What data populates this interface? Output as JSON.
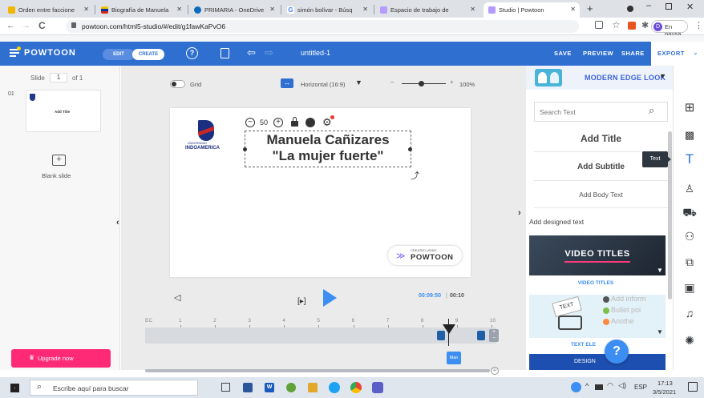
{
  "browser": {
    "tabs": [
      {
        "label": "Orden entre faccione",
        "color": "#f2b705",
        "active": false
      },
      {
        "label": "Biografía de Manuela",
        "color": "#d9261c",
        "active": false
      },
      {
        "label": "PRIMARIA - OneDrive",
        "color": "#0f6cbd",
        "active": false
      },
      {
        "label": "simón bolívar - Búsq",
        "color": "#4285f4",
        "active": false
      },
      {
        "label": "Espacio de trabajo de",
        "color": "#7b61ff",
        "active": false
      },
      {
        "label": "Studio | Powtoon",
        "color": "#7b61ff",
        "active": true
      }
    ],
    "new_tab": "+",
    "url": "powtoon.com/html5-studio/#/edit/g1fawKaPvO6",
    "profile_initial": "D",
    "profile_status": "En pausa"
  },
  "toolbar": {
    "logo": "POWTOON",
    "mode_edit": "EDIT",
    "mode_create": "CREATE",
    "doc_title": "untitled-1",
    "save": "SAVE",
    "preview": "PREVIEW",
    "share": "SHARE",
    "export": "EXPORT"
  },
  "slides_panel": {
    "slide_label": "Slide",
    "slide_current": "1",
    "slide_of": "of 1",
    "thumb_number": "01",
    "thumb_title": "Add Title",
    "blank_slide": "Blank slide",
    "upgrade": "Upgrade now"
  },
  "canvas_bar": {
    "grid_label": "Grid",
    "aspect_label": "Horizontal (16:9)",
    "zoom_minus": "–",
    "zoom_plus": "+",
    "zoom_value": "100%",
    "zoom_fraction": 0.45
  },
  "canvas": {
    "font_size": "50",
    "text_line1": "Manuela Cañizares",
    "text_line2": "\"La mujer fuerte\"",
    "logo_text": "INDOAMERICA",
    "logo_small": "UNIVERSIDAD",
    "badge_small": "CREATED USING",
    "badge_brand": "POWTOON"
  },
  "timeline": {
    "time_current": "00:09:50",
    "time_total": "00:10",
    "ec_label": "EC",
    "ticks": [
      "1",
      "2",
      "3",
      "4",
      "5",
      "6",
      "7",
      "8",
      "9",
      "10"
    ],
    "marker_label": "Man"
  },
  "right_panel": {
    "style_title": "MODERN EDGE LOOK",
    "search_placeholder": "Search Text",
    "add_title": "Add Title",
    "add_subtitle": "Add Subtitle",
    "add_body": "Add Body Text",
    "designed_heading": "Add designed text",
    "video_titles_banner": "VIDEO TITLES",
    "video_titles_label": "VIDEO TITLES",
    "text_card_tag": "TEXT",
    "text_card_lines": [
      "Add inform",
      "Bullet poi",
      "Anothe"
    ],
    "text_elements_label": "TEXT ELE",
    "designed_label": "DESIGN",
    "tooltip_text": "Text",
    "help": "?"
  },
  "taskbar": {
    "search_placeholder": "Escribe aquí para buscar",
    "lang": "ESP",
    "time": "17:13",
    "date": "3/5/2021"
  },
  "colors": {
    "powtoon_blue": "#2f6fd0",
    "accent_blue": "#3d8ef2",
    "upgrade_pink": "#ff2a76",
    "style_title": "#3b63d8"
  }
}
